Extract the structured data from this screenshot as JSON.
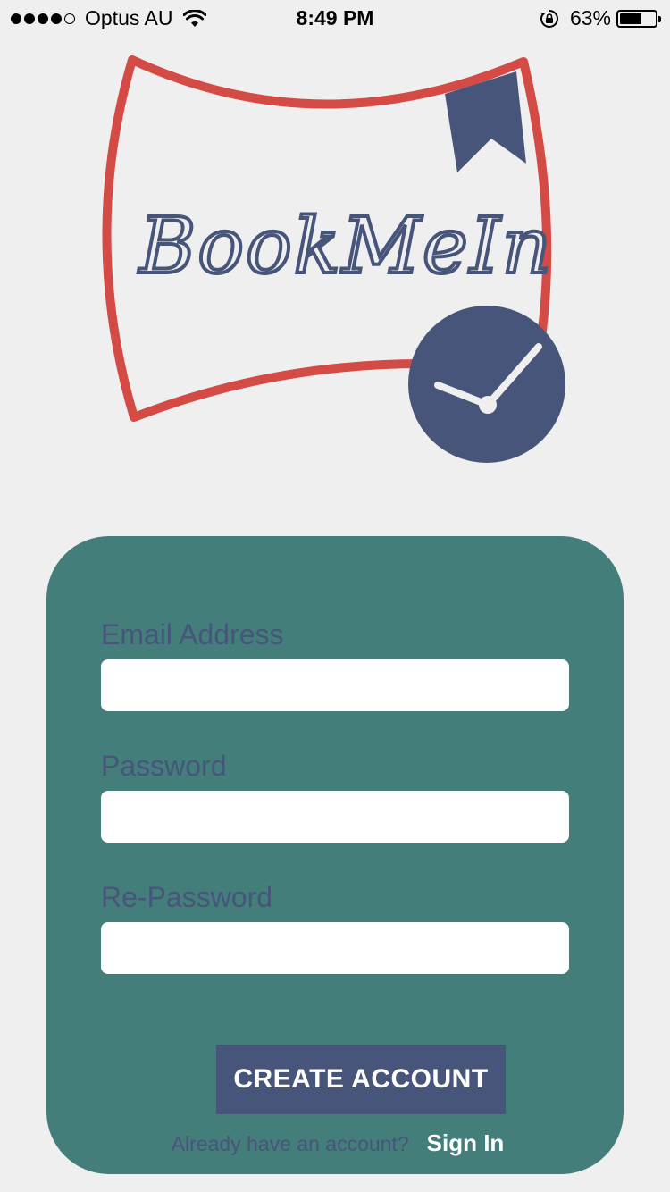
{
  "status_bar": {
    "carrier": "Optus AU",
    "time": "8:49 PM",
    "battery_percent": "63%",
    "battery_level": 0.63,
    "signal_strength": "4 of 5 dots",
    "icons": [
      "signal-dots-icon",
      "wifi-icon",
      "rotation-lock-icon",
      "battery-icon"
    ]
  },
  "logo": {
    "wordmark": "BookMeIn",
    "colors": {
      "frame": "#d44a45",
      "ink": "#47557a",
      "clock_hands": "#efefef"
    }
  },
  "form": {
    "fields": [
      {
        "label": "Email Address",
        "value": "",
        "placeholder": ""
      },
      {
        "label": "Password",
        "value": "",
        "placeholder": ""
      },
      {
        "label": "Re-Password",
        "value": "",
        "placeholder": ""
      }
    ],
    "create_button": "CREATE ACCOUNT",
    "already_text": "Already have an account?",
    "signin_link": "Sign In"
  },
  "colors": {
    "background": "#efefef",
    "card": "#437e7b",
    "accent": "#47557a",
    "input_bg": "#ffffff"
  }
}
